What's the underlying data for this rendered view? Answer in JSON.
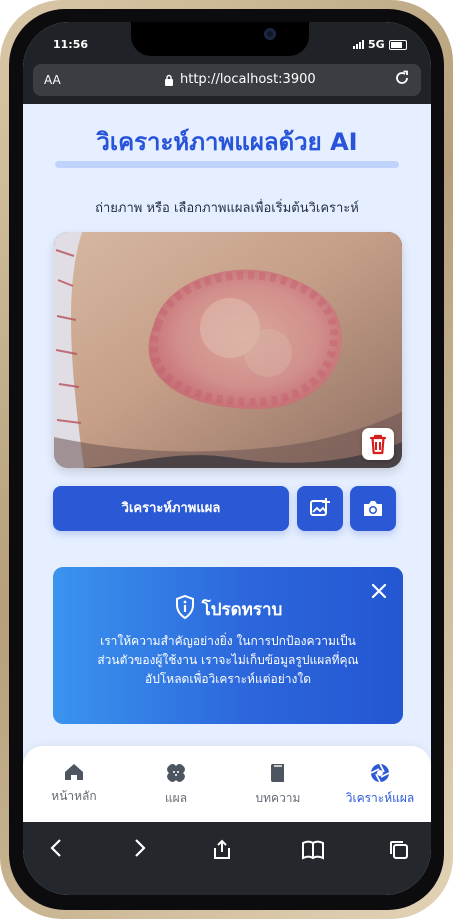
{
  "status": {
    "time": "11:56",
    "network": "5G"
  },
  "browser": {
    "text_size_label": "AA",
    "url": "http://localhost:3900"
  },
  "page": {
    "title": "วิเคราะห์ภาพแผลด้วย AI",
    "subtitle": "ถ่ายภาพ หรือ เลือกภาพแผลเพื่อเริ่มต้นวิเคราะห์",
    "analyze_button_label": "วิเคราะห์ภาพแผล"
  },
  "notice": {
    "title": "โปรดทราบ",
    "lines": [
      "เราให้ความสำคัญอย่างยิ่ง ในการปกป้องความเป็น",
      "ส่วนตัวของผู้ใช้งาน เราจะไม่เก็บข้อมูลรูปแผลที่คุณ",
      "อัปโหลดเพื่อวิเคราะห์แต่อย่างใด"
    ]
  },
  "tabs": [
    {
      "label": "หน้าหลัก",
      "icon": "home-icon"
    },
    {
      "label": "แผล",
      "icon": "bandage-icon"
    },
    {
      "label": "บทความ",
      "icon": "book-icon"
    },
    {
      "label": "วิเคราะห์แผล",
      "icon": "camera-aperture-icon",
      "active": true
    }
  ],
  "colors": {
    "primary": "#2b59d6",
    "title": "#2754d9",
    "background": "#e6efff",
    "danger": "#d61e1e"
  }
}
